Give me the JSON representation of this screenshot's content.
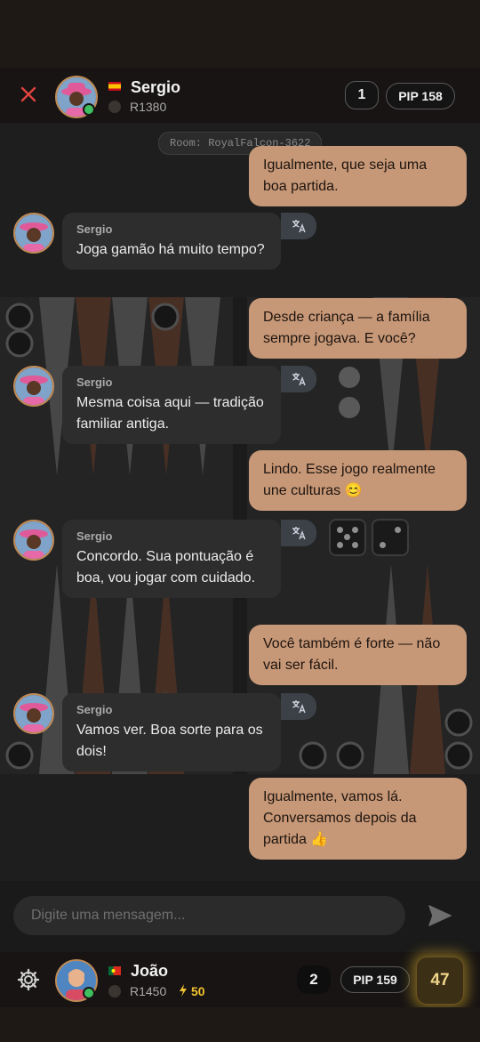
{
  "opponent": {
    "name": "Sergio",
    "rating": "R1380",
    "score": "1",
    "pip": "PIP 158",
    "flag": "es"
  },
  "room": {
    "label": "Room: RoyalFalcon-3622"
  },
  "messages": [
    {
      "dir": "out",
      "text": "Igualmente, que seja uma boa partida."
    },
    {
      "dir": "in",
      "sender": "Sergio",
      "text": "Joga gamão há muito tempo?"
    },
    {
      "dir": "out",
      "text": "Desde criança — a família sempre jogava. E você?"
    },
    {
      "dir": "in",
      "sender": "Sergio",
      "text": "Mesma coisa aqui — tradição familiar antiga."
    },
    {
      "dir": "out",
      "text": "Lindo. Esse jogo realmente une culturas 😊"
    },
    {
      "dir": "in",
      "sender": "Sergio",
      "text": "Concordo. Sua pontuação é boa, vou jogar com cuidado."
    },
    {
      "dir": "out",
      "text": "Você também é forte — não vai ser fácil."
    },
    {
      "dir": "in",
      "sender": "Sergio",
      "text": "Vamos ver. Boa sorte para os dois!"
    },
    {
      "dir": "out",
      "text": "Igualmente, vamos lá. Conversamos depois da partida 👍"
    }
  ],
  "composer": {
    "placeholder": "Digite uma mensagem..."
  },
  "player": {
    "name": "João",
    "rating": "R1450",
    "energy": "50",
    "score": "2",
    "pip": "PIP 159",
    "timer": "47",
    "flag": "pt"
  },
  "icons": {
    "close": "close-icon",
    "translate": "translate-icon",
    "send": "send-icon",
    "settings": "gear-icon",
    "energy": "lightning-icon",
    "rank": "shield-icon"
  },
  "colors": {
    "outgoing_bubble": "#c79877",
    "incoming_bubble": "#2d2d2d",
    "close": "#e0443e",
    "online": "#3fbf5f",
    "timer_glow": "#c9a12b"
  }
}
